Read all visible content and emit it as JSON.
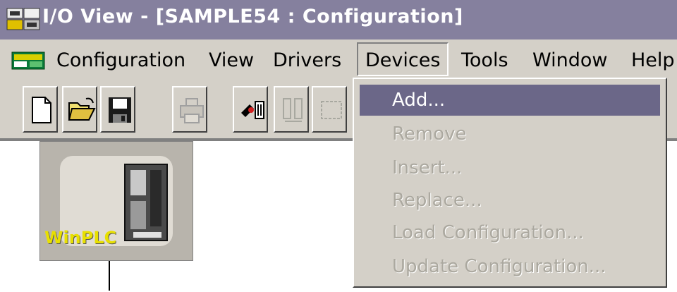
{
  "window": {
    "title": "I/O View - [SAMPLE54 : Configuration]"
  },
  "menubar": {
    "items": [
      {
        "label": "Configuration"
      },
      {
        "label": "View"
      },
      {
        "label": "Drivers"
      },
      {
        "label": "Devices"
      },
      {
        "label": "Tools"
      },
      {
        "label": "Window"
      },
      {
        "label": "Help"
      }
    ],
    "open_menu": "Devices"
  },
  "toolbar": {
    "buttons": [
      {
        "icon": "new-document-icon",
        "enabled": true
      },
      {
        "icon": "open-folder-icon",
        "enabled": true
      },
      {
        "icon": "save-disk-icon",
        "enabled": true
      },
      {
        "icon": "print-icon",
        "enabled": false
      },
      {
        "icon": "connect-device-icon",
        "enabled": true
      },
      {
        "icon": "transfer-icon",
        "enabled": false
      },
      {
        "icon": "frame-icon",
        "enabled": false
      }
    ]
  },
  "devices_menu": {
    "items": [
      {
        "label": "Add...",
        "enabled": true,
        "highlighted": true
      },
      {
        "label": "Remove",
        "enabled": false
      },
      {
        "label": "Insert...",
        "enabled": false
      },
      {
        "label": "Replace...",
        "enabled": false
      },
      {
        "label": "Load Configuration...",
        "enabled": false
      },
      {
        "label": "Update Configuration...",
        "enabled": false
      }
    ]
  },
  "workspace": {
    "device": {
      "label": "WinPLC"
    }
  },
  "colors": {
    "titlebar": "#85809e",
    "menu_highlight": "#6b6788",
    "face": "#d4d0c8",
    "disabled_text": "#aba89f"
  }
}
